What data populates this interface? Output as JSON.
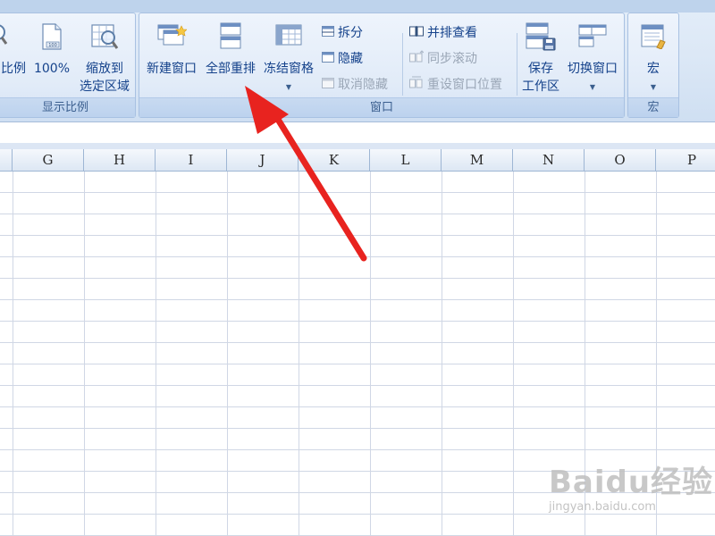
{
  "ribbon": {
    "zoom_group": {
      "title": "显示比例",
      "zoom_button": "比例",
      "hundred_button": "100%",
      "zoom_to_selection_line1": "缩放到",
      "zoom_to_selection_line2": "选定区域"
    },
    "window_group": {
      "title": "窗口",
      "new_window": "新建窗口",
      "arrange_all": "全部重排",
      "freeze_panes": "冻结窗格",
      "split": "拆分",
      "hide": "隐藏",
      "unhide": "取消隐藏",
      "view_side_by_side": "并排查看",
      "sync_scroll": "同步滚动",
      "reset_window_position": "重设窗口位置",
      "save_workspace_line1": "保存",
      "save_workspace_line2": "工作区",
      "switch_windows": "切换窗口"
    },
    "macro_group": {
      "title": "宏",
      "macros": "宏"
    }
  },
  "grid": {
    "columns": [
      "G",
      "H",
      "I",
      "J",
      "K",
      "L",
      "M",
      "N",
      "O",
      "P"
    ]
  },
  "watermark": {
    "logo_text": "Baidu经验",
    "url": "jingyan.baidu.com"
  },
  "colors": {
    "ribbon_bg": "#dce8f6",
    "ribbon_text": "#15428b",
    "grid_line": "#d0d7e5",
    "arrow": "#e8231f"
  }
}
